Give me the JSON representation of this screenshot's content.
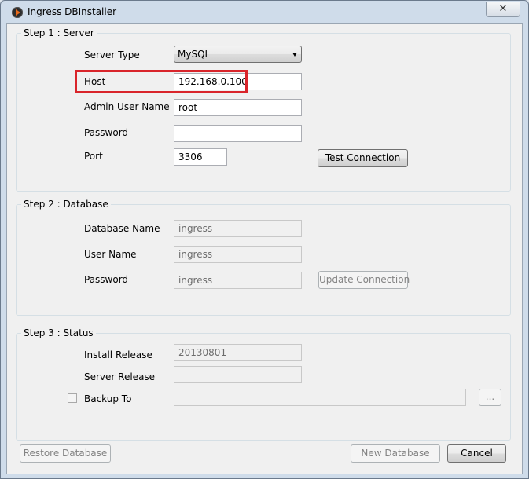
{
  "window": {
    "title": "Ingress DBInstaller",
    "close_glyph": "✕"
  },
  "step1": {
    "legend": "Step 1 : Server",
    "server_type_label": "Server Type",
    "server_type_value": "MySQL",
    "host_label": "Host",
    "host_value": "192.168.0.100",
    "admin_user_label": "Admin User Name",
    "admin_user_value": "root",
    "password_label": "Password",
    "password_value": "",
    "port_label": "Port",
    "port_value": "3306",
    "test_connection_label": "Test Connection"
  },
  "step2": {
    "legend": "Step 2 : Database",
    "db_name_label": "Database Name",
    "db_name_value": "ingress",
    "user_name_label": "User Name",
    "user_name_value": "ingress",
    "password_label": "Password",
    "password_value": "ingress",
    "update_connection_label": "Update Connection"
  },
  "step3": {
    "legend": "Step 3 : Status",
    "install_release_label": "Install Release",
    "install_release_value": "20130801",
    "server_release_label": "Server Release",
    "server_release_value": "",
    "backup_to_label": "Backup To",
    "backup_to_value": "",
    "browse_label": "..."
  },
  "footer": {
    "restore_label": "Restore Database",
    "new_db_label": "New Database",
    "cancel_label": "Cancel"
  },
  "colors": {
    "highlight": "#d9252b",
    "accent_icon": "#e86a1b"
  }
}
